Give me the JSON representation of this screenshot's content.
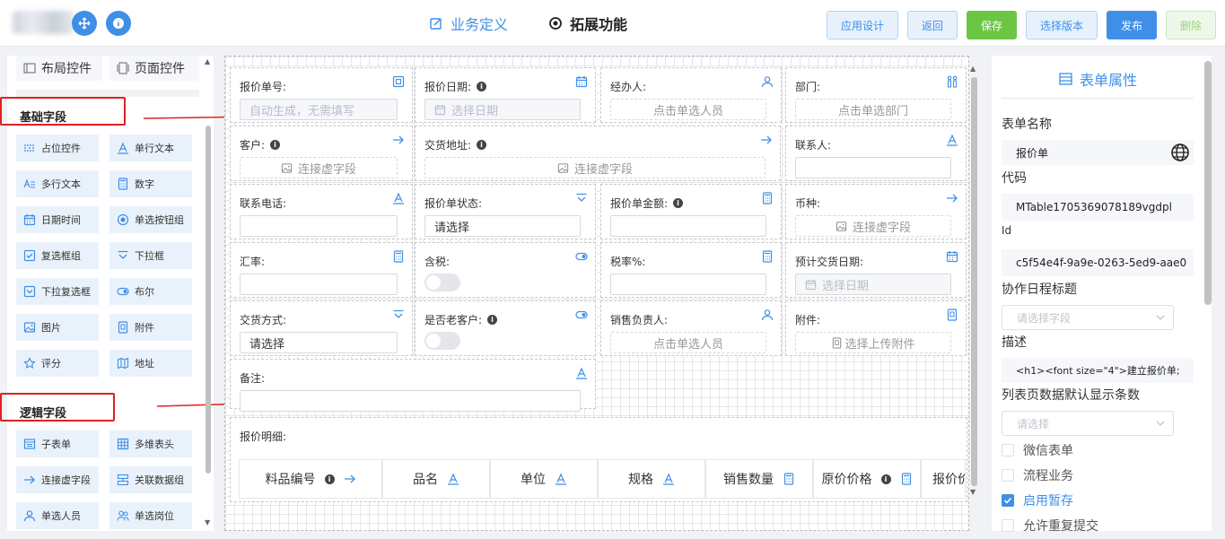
{
  "colors": {
    "accent": "#3f8fe8",
    "save": "#6cc644",
    "annotation": "#e02020"
  },
  "header": {
    "tabs": [
      {
        "label": "业务定义",
        "icon": "edit-icon",
        "active": false
      },
      {
        "label": "拓展功能",
        "icon": "dot-circle-icon",
        "active": true
      }
    ],
    "buttons": {
      "app_design": "应用设计",
      "back": "返回",
      "save": "保存",
      "choose_version": "选择版本",
      "publish": "发布",
      "delete": "删除"
    }
  },
  "left": {
    "tabs": {
      "layout": "布局控件",
      "page": "页面控件"
    },
    "basic_title": "基础字段",
    "basic_items": [
      {
        "label": "占位控件",
        "icon": "placeholder-icon"
      },
      {
        "label": "单行文本",
        "icon": "text-a-icon"
      },
      {
        "label": "多行文本",
        "icon": "multiline-text-icon"
      },
      {
        "label": "数字",
        "icon": "calculator-icon"
      },
      {
        "label": "日期时间",
        "icon": "calendar-icon"
      },
      {
        "label": "单选按钮组",
        "icon": "radio-icon"
      },
      {
        "label": "复选框组",
        "icon": "checkbox-icon"
      },
      {
        "label": "下拉框",
        "icon": "dropdown-icon"
      },
      {
        "label": "下拉复选框",
        "icon": "dropdown-checkbox-icon"
      },
      {
        "label": "布尔",
        "icon": "toggle-icon"
      },
      {
        "label": "图片",
        "icon": "image-icon"
      },
      {
        "label": "附件",
        "icon": "attachment-icon"
      },
      {
        "label": "评分",
        "icon": "star-icon"
      },
      {
        "label": "地址",
        "icon": "map-icon"
      }
    ],
    "logic_title": "逻辑字段",
    "logic_items": [
      {
        "label": "子表单",
        "icon": "subform-icon"
      },
      {
        "label": "多维表头",
        "icon": "grid-icon"
      },
      {
        "label": "连接虚字段",
        "icon": "arrow-right-icon"
      },
      {
        "label": "关联数据组",
        "icon": "link-data-icon"
      },
      {
        "label": "单选人员",
        "icon": "user-icon"
      },
      {
        "label": "单选岗位",
        "icon": "users-icon"
      }
    ]
  },
  "form": {
    "quote_no": {
      "label": "报价单号:",
      "placeholder": "自动生成，无需填写"
    },
    "quote_date": {
      "label": "报价日期:",
      "placeholder": "选择日期"
    },
    "handler": {
      "label": "经办人:",
      "placeholder": "点击单选人员"
    },
    "dept": {
      "label": "部门:",
      "placeholder": "点击单选部门"
    },
    "customer": {
      "label": "客户:",
      "placeholder": "连接虚字段"
    },
    "delivery_addr": {
      "label": "交货地址:",
      "placeholder": "连接虚字段"
    },
    "contact": {
      "label": "联系人:"
    },
    "phone": {
      "label": "联系电话:"
    },
    "status": {
      "label": "报价单状态:",
      "value": "请选择"
    },
    "amount": {
      "label": "报价单金额:"
    },
    "currency": {
      "label": "币种:",
      "placeholder": "连接虚字段"
    },
    "rate": {
      "label": "汇率:"
    },
    "tax": {
      "label": "含税:",
      "checked": false
    },
    "tax_rate": {
      "label": "税率%:"
    },
    "est_delivery": {
      "label": "预计交货日期:",
      "placeholder": "选择日期"
    },
    "delivery_method": {
      "label": "交货方式:",
      "value": "请选择"
    },
    "old_customer": {
      "label": "是否老客户:",
      "checked": false
    },
    "sales_owner": {
      "label": "销售负责人:",
      "placeholder": "点击单选人员"
    },
    "attachment": {
      "label": "附件:",
      "placeholder": "选择上传附件"
    },
    "remark": {
      "label": "备注:"
    },
    "detail": {
      "label": "报价明细:",
      "columns": [
        "料品编号",
        "品名",
        "单位",
        "规格",
        "销售数量",
        "原价价格",
        "报价价"
      ]
    }
  },
  "right": {
    "title": "表单属性",
    "form_name_label": "表单名称",
    "form_name": "报价单",
    "code_label": "代码",
    "code": "MTable1705369078189vgdpl",
    "id_label": "Id",
    "id": "c5f54e4f-9a9e-0263-5ed9-aae0",
    "schedule_label": "协作日程标题",
    "schedule_placeholder": "请选择字段",
    "desc_label": "描述",
    "desc": "<h1><font size=\"4\">建立报价单;",
    "rows_label": "列表页数据默认显示条数",
    "rows_placeholder": "请选择",
    "checks": [
      {
        "label": "微信表单",
        "checked": false
      },
      {
        "label": "流程业务",
        "checked": false
      },
      {
        "label": "启用暂存",
        "checked": true
      },
      {
        "label": "允许重复提交",
        "checked": false
      }
    ]
  }
}
